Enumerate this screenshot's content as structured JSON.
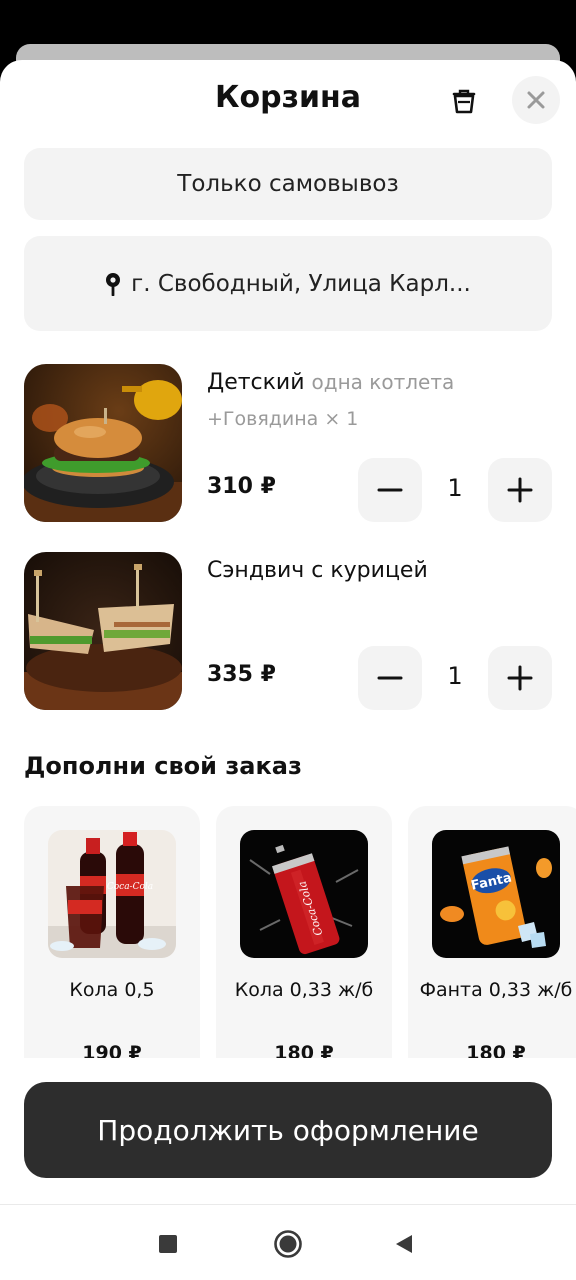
{
  "header": {
    "title": "Корзина"
  },
  "delivery": {
    "mode": "Только самовывоз",
    "address": "г. Свободный, Улица Карл..."
  },
  "cart_items": [
    {
      "name": "Детский",
      "variant": "одна котлета",
      "modifier": "+Говядина × 1",
      "price": "310 ₽",
      "quantity": "1"
    },
    {
      "name": "Сэндвич с курицей",
      "variant": "",
      "modifier": "",
      "price": "335 ₽",
      "quantity": "1"
    }
  ],
  "upsell": {
    "title": "Дополни свой заказ",
    "items": [
      {
        "name": "Кола 0,5",
        "price": "190 ₽"
      },
      {
        "name": "Кола 0,33 ж/б",
        "price": "180 ₽"
      },
      {
        "name": "Фанта 0,33 ж/б",
        "price": "180 ₽"
      }
    ]
  },
  "cta": {
    "label": "Продолжить оформление"
  },
  "colors": {
    "accent": "#2d2d2d",
    "surface": "#f3f3f3",
    "muted_text": "#9a9a9a"
  }
}
